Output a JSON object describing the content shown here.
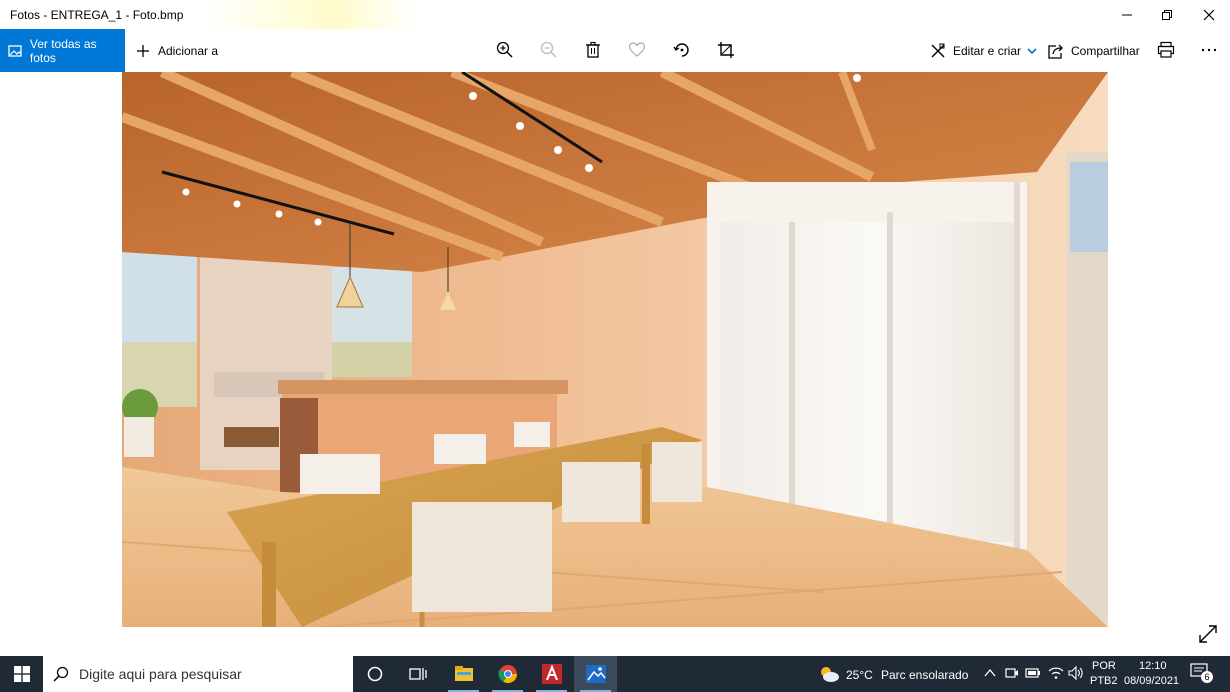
{
  "window": {
    "title": "Fotos - ENTREGA_1 - Foto.bmp",
    "minimize_icon": "minimize-icon",
    "maximize_icon": "restore-icon",
    "close_icon": "close-icon"
  },
  "toolbar": {
    "view_all_label": "Ver todas as fotos",
    "add_label": "Adicionar a",
    "edit_create_label": "Editar e criar",
    "share_label": "Compartilhar",
    "icons": [
      "zoom-in-icon",
      "zoom-out-icon",
      "delete-icon",
      "favorite-icon",
      "rotate-icon",
      "crop-icon",
      "print-icon",
      "more-icon"
    ]
  },
  "taskbar": {
    "search_placeholder": "Digite aqui para pesquisar",
    "weather_temp": "25°C",
    "weather_desc": "Parc ensolarado",
    "language": "POR",
    "keyboard": "PTB2",
    "time": "12:10",
    "date": "08/09/2021",
    "notification_count": "6"
  },
  "colors": {
    "accent": "#0078d7",
    "taskbar_bg": "#1f2a36"
  }
}
